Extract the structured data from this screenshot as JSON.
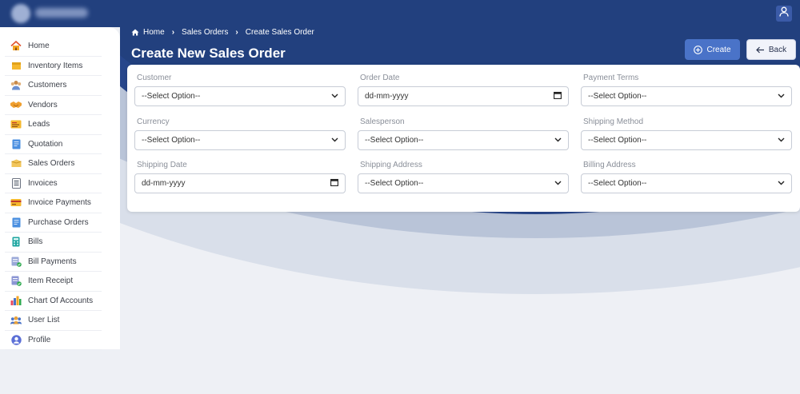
{
  "header": {
    "breadcrumb": {
      "home": "Home",
      "parent": "Sales Orders",
      "current": "Create Sales Order"
    },
    "title": "Create New Sales Order",
    "create_label": "Create",
    "back_label": "Back"
  },
  "sidebar": {
    "items": [
      {
        "label": "Home",
        "icon": "home-icon"
      },
      {
        "label": "Inventory Items",
        "icon": "box-icon"
      },
      {
        "label": "Customers",
        "icon": "customers-icon"
      },
      {
        "label": "Vendors",
        "icon": "handshake-icon"
      },
      {
        "label": "Leads",
        "icon": "leads-icon"
      },
      {
        "label": "Quotation",
        "icon": "document-icon"
      },
      {
        "label": "Sales Orders",
        "icon": "box-icon"
      },
      {
        "label": "Invoices",
        "icon": "invoice-icon"
      },
      {
        "label": "Invoice Payments",
        "icon": "payment-icon"
      },
      {
        "label": "Purchase Orders",
        "icon": "document-icon"
      },
      {
        "label": "Bills",
        "icon": "calculator-icon"
      },
      {
        "label": "Bill Payments",
        "icon": "bill-check-icon"
      },
      {
        "label": "Item Receipt",
        "icon": "receipt-check-icon"
      },
      {
        "label": "Chart Of Accounts",
        "icon": "bar-chart-icon"
      },
      {
        "label": "User List",
        "icon": "users-icon"
      },
      {
        "label": "Profile",
        "icon": "profile-icon"
      }
    ]
  },
  "form": {
    "fields": [
      {
        "label": "Customer",
        "value": "--Select Option--",
        "kind": "select"
      },
      {
        "label": "Order Date",
        "value": "dd-mm-yyyy",
        "kind": "date"
      },
      {
        "label": "Payment Terms",
        "value": "--Select Option--",
        "kind": "select"
      },
      {
        "label": "Currency",
        "value": "--Select Option--",
        "kind": "select"
      },
      {
        "label": "Salesperson",
        "value": "--Select Option--",
        "kind": "select"
      },
      {
        "label": "Shipping Method",
        "value": "--Select Option--",
        "kind": "select"
      },
      {
        "label": "Shipping Date",
        "value": "dd-mm-yyyy",
        "kind": "date"
      },
      {
        "label": "Shipping Address",
        "value": "--Select Option--",
        "kind": "select"
      },
      {
        "label": "Billing Address",
        "value": "--Select Option--",
        "kind": "select"
      }
    ]
  },
  "colors": {
    "topbar": "#22407e",
    "accent": "#4a73c8",
    "page_bg": "#eef0f5"
  }
}
